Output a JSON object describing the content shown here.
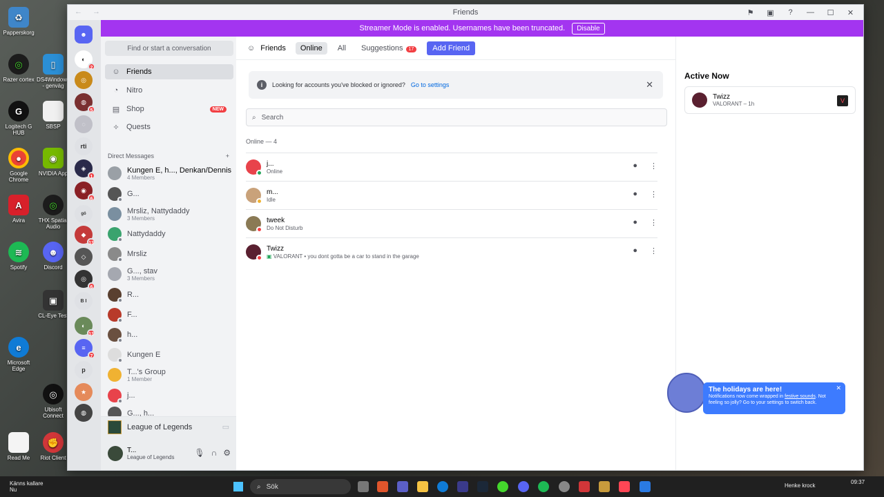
{
  "window": {
    "title": "Friends"
  },
  "banner": {
    "text": "Streamer Mode is enabled. Usernames have been truncated.",
    "button": "Disable"
  },
  "rail": {
    "badges": [
      "2",
      "5",
      "1",
      "6",
      "13",
      "6",
      "13",
      "7"
    ],
    "labels": [
      "rti",
      "B I",
      "p"
    ]
  },
  "sidebar": {
    "find_placeholder": "Find or start a conversation",
    "nav": [
      {
        "label": "Friends",
        "icon": "friends-icon"
      },
      {
        "label": "Nitro",
        "icon": "nitro-icon"
      },
      {
        "label": "Shop",
        "icon": "shop-icon",
        "badge": "NEW"
      },
      {
        "label": "Quests",
        "icon": "quests-icon"
      }
    ],
    "dm_header": "Direct Messages",
    "dms": [
      {
        "name": "Kungen E, h..., Denkan/Dennis",
        "sub": "4 Members"
      },
      {
        "name": "G...",
        "sub": ""
      },
      {
        "name": "Mrsliz, Nattydaddy",
        "sub": "3 Members"
      },
      {
        "name": "Nattydaddy",
        "sub": ""
      },
      {
        "name": "Mrsliz",
        "sub": ""
      },
      {
        "name": "G..., stav",
        "sub": "3 Members"
      },
      {
        "name": "R...",
        "sub": ""
      },
      {
        "name": "F...",
        "sub": ""
      },
      {
        "name": "h...",
        "sub": ""
      },
      {
        "name": "Kungen E",
        "sub": ""
      },
      {
        "name": "T...'s Group",
        "sub": "1 Member"
      },
      {
        "name": "j...",
        "sub": ""
      },
      {
        "name": "G..., h...",
        "sub": ""
      }
    ],
    "activity": "League of Legends",
    "user": {
      "name": "T...",
      "status": "League of Legends"
    }
  },
  "main": {
    "tabs": [
      "Friends",
      "Online",
      "All",
      "Suggestions"
    ],
    "suggestions_count": "17",
    "add_friend": "Add Friend",
    "notice": {
      "text": "Looking for accounts you've blocked or ignored?",
      "link": "Go to settings"
    },
    "search_placeholder": "Search",
    "online_label": "Online — 4",
    "friends": [
      {
        "name": "j...",
        "status": "Online",
        "status_color": "#23a55a",
        "avatar_color": "#e8434b"
      },
      {
        "name": "m...",
        "status": "Idle",
        "status_color": "#f0b232",
        "avatar_color": "#c9a27a"
      },
      {
        "name": "tweek",
        "status": "Do Not Disturb",
        "status_color": "#f23f43",
        "avatar_color": "#8a7a55"
      },
      {
        "name": "Twizz",
        "status": "VALORANT • you dont gotta be a car to stand in the garage",
        "status_color": "#f23f43",
        "avatar_color": "#5a2030"
      }
    ]
  },
  "active_now": {
    "title": "Active Now",
    "entries": [
      {
        "name": "Twizz",
        "activity": "VALORANT – 1h"
      }
    ]
  },
  "holiday_popup": {
    "title": "The holidays are here!",
    "body_prefix": "Notifications now come wrapped in",
    "body_link": "festive sounds",
    "body_suffix": ". Not feeling so jolly? Go to your settings to switch back."
  },
  "desktop_icons": [
    "Papperskorg",
    "Razer cortex",
    "DS4Windows - genväg",
    "Logitech G HUB",
    "SBSP",
    "Google Chrome",
    "NVIDIA App",
    "Avira",
    "THX Spatial Audio",
    "Spotify",
    "Discord",
    "CL-Eye Test",
    "Microsoft Edge",
    "Ubisoft Connect",
    "Read Me",
    "Riot Client"
  ],
  "taskbar": {
    "weather_title": "Känns kallare",
    "weather_sub": "Nu",
    "search": "Sök",
    "user": "Henke krock",
    "time": "09:37"
  },
  "colors": {
    "brand": "#5865f2",
    "banner": "#a335f0",
    "holiday": "#3d7bff"
  }
}
